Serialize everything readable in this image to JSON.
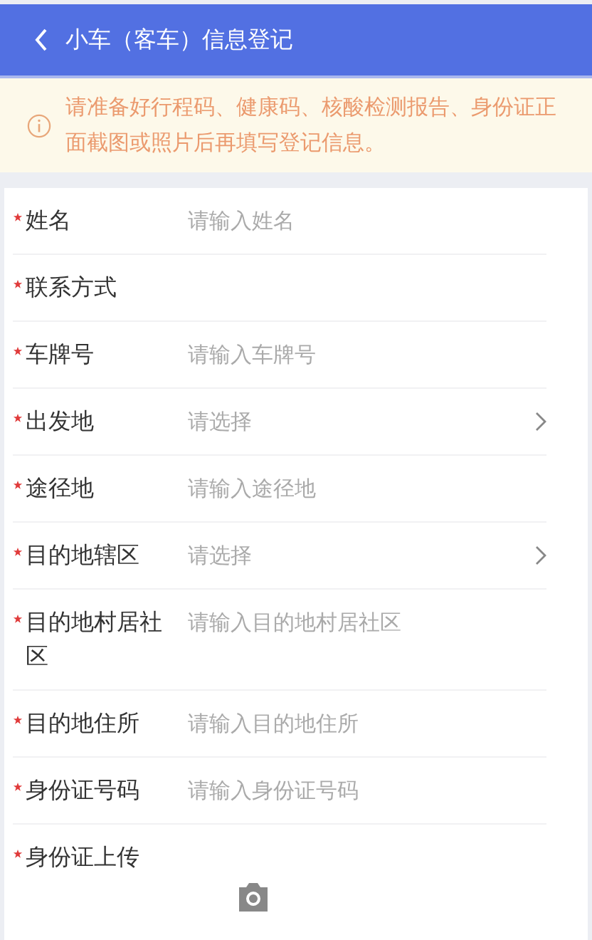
{
  "header": {
    "title": "小车（客车）信息登记"
  },
  "notice": {
    "text": "请准备好行程码、健康码、核酸检测报告、身份证正面截图或照片后再填写登记信息。"
  },
  "fields": [
    {
      "kind": "input",
      "label": "姓名",
      "required": true,
      "placeholder": "请输入姓名"
    },
    {
      "kind": "input",
      "label": "联系方式",
      "required": true
    },
    {
      "kind": "input",
      "label": "车牌号",
      "required": true,
      "placeholder": "请输入车牌号"
    },
    {
      "kind": "select",
      "label": "出发地",
      "required": true,
      "placeholder": "请选择"
    },
    {
      "kind": "input",
      "label": "途径地",
      "required": true,
      "placeholder": "请输入途径地"
    },
    {
      "kind": "select",
      "label": "目的地辖区",
      "required": true,
      "placeholder": "请选择"
    },
    {
      "kind": "input",
      "label": "目的地村居社区",
      "required": true,
      "placeholder": "请输入目的地村居社区"
    },
    {
      "kind": "input",
      "label": "目的地住所",
      "required": true,
      "placeholder": "请输入目的地住所"
    },
    {
      "kind": "input",
      "label": "身份证号码",
      "required": true,
      "placeholder": "请输入身份证号码"
    },
    {
      "kind": "upload",
      "label": "身份证上传",
      "required": true
    }
  ]
}
